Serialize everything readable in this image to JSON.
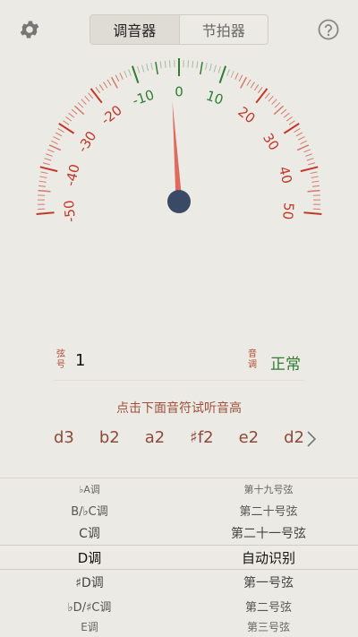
{
  "tabs": [
    {
      "label": "调音器",
      "active": true
    },
    {
      "label": "节拍器",
      "active": false
    }
  ],
  "dial": {
    "labels": [
      "-50",
      "-40",
      "-30",
      "-20",
      "-10",
      "0",
      "10",
      "20",
      "30",
      "40",
      "50"
    ],
    "needle_value": -2,
    "colors": {
      "center": "#2e7d32",
      "side": "#c0392b",
      "needle": "#e06a5e",
      "hub": "#3a4a66"
    }
  },
  "string_row": {
    "label_left_top": "弦",
    "label_left_bottom": "号",
    "value": "1",
    "label_right_top": "音",
    "label_right_bottom": "调",
    "status": "正常"
  },
  "hint": "点击下面音符试听音高",
  "notes": [
    "d3",
    "b2",
    "a2",
    "♯f2",
    "e2",
    "d2"
  ],
  "picker": {
    "left": [
      "♭A调",
      "B/♭C调",
      "C调",
      "D调",
      "♯D调",
      "♭D/♯C调",
      "E调"
    ],
    "right": [
      "第十九号弦",
      "第二十号弦",
      "第二十一号弦",
      "自动识别",
      "第一号弦",
      "第二号弦",
      "第三号弦"
    ]
  }
}
